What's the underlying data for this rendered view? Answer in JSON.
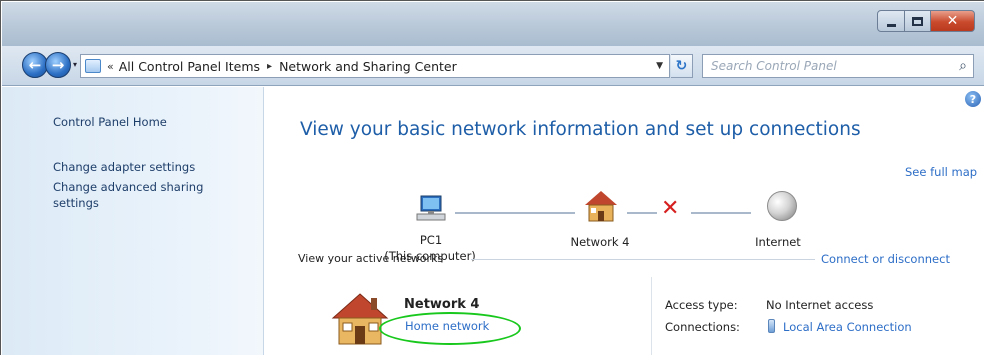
{
  "window": {
    "controls": {
      "minimize_icon": "minimize-icon",
      "maximize_icon": "maximize-icon",
      "close_icon": "close-icon"
    }
  },
  "navigation": {
    "address_chevron": "«",
    "breadcrumb": [
      "All Control Panel Items",
      "Network and Sharing Center"
    ],
    "search_placeholder": "Search Control Panel"
  },
  "sidebar": {
    "items": [
      {
        "label": "Control Panel Home"
      },
      {
        "label": "Change adapter settings"
      },
      {
        "label": "Change advanced sharing settings"
      }
    ]
  },
  "main": {
    "heading": "View your basic network information and set up connections",
    "see_full_map": "See full map",
    "map": {
      "computer_name": "PC1",
      "computer_sub": "(This computer)",
      "network_name": "Network 4",
      "internet_label": "Internet"
    },
    "active_networks": {
      "title": "View your active networks",
      "connect_link": "Connect or disconnect",
      "network_name": "Network 4",
      "network_type": "Home network",
      "access_type_label": "Access type:",
      "access_type_value": "No Internet access",
      "connections_label": "Connections:",
      "connections_value": "Local Area Connection"
    }
  },
  "colors": {
    "link": "#2d6ec7",
    "heading": "#1e5ea8",
    "highlight": "#19c81d",
    "error_x": "#d62020"
  }
}
